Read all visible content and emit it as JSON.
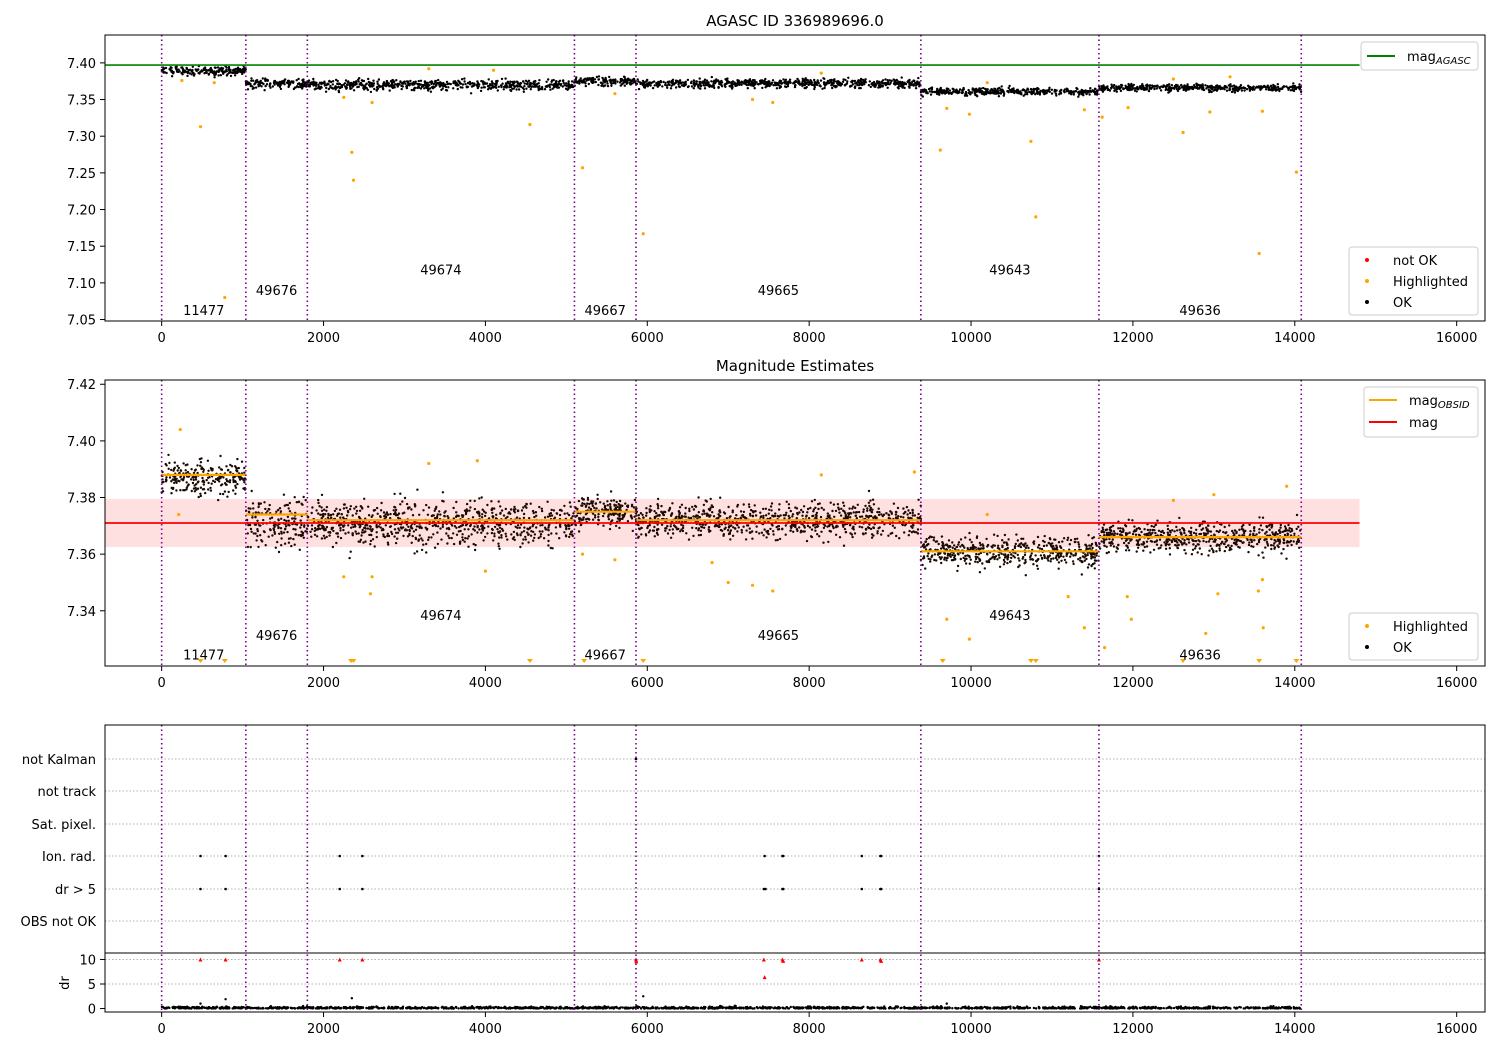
{
  "figure": {
    "title": "AGASC ID 336989696.0"
  },
  "chart_data": [
    {
      "type": "scatter",
      "title": "AGASC ID 336989696.0",
      "xlim": [
        -700,
        16350
      ],
      "ylim": [
        7.048,
        7.438
      ],
      "x_ticks": [
        0,
        2000,
        4000,
        6000,
        8000,
        10000,
        12000,
        14000,
        16000
      ],
      "y_ticks": [
        7.05,
        7.1,
        7.15,
        7.2,
        7.25,
        7.3,
        7.35,
        7.4
      ],
      "y_tick_labels": [
        "7.05",
        "7.10",
        "7.15",
        "7.20",
        "7.25",
        "7.30",
        "7.35",
        "7.40"
      ],
      "reference_line": {
        "name": "mag",
        "subscript": "AGASC",
        "y": 7.397,
        "x_end": 14800,
        "color": "#008000"
      },
      "obs_boundaries": [
        0,
        1040,
        1800,
        5100,
        5860,
        9380,
        11580,
        14080
      ],
      "obs_labels": [
        {
          "text": "11477",
          "x": 520,
          "y": 7.063
        },
        {
          "text": "49676",
          "x": 1420,
          "y": 7.09
        },
        {
          "text": "49674",
          "x": 3450,
          "y": 7.118
        },
        {
          "text": "49667",
          "x": 5480,
          "y": 7.063
        },
        {
          "text": "49665",
          "x": 7620,
          "y": 7.09
        },
        {
          "text": "49643",
          "x": 10480,
          "y": 7.118
        },
        {
          "text": "49636",
          "x": 12830,
          "y": 7.063
        }
      ],
      "segments": [
        {
          "x": [
            0,
            1040
          ],
          "mean": 7.389,
          "spread": 0.005
        },
        {
          "x": [
            1040,
            1800
          ],
          "mean": 7.372,
          "spread": 0.006
        },
        {
          "x": [
            1800,
            5100
          ],
          "mean": 7.37,
          "spread": 0.006
        },
        {
          "x": [
            5100,
            5860
          ],
          "mean": 7.375,
          "spread": 0.005
        },
        {
          "x": [
            5860,
            9380
          ],
          "mean": 7.372,
          "spread": 0.005
        },
        {
          "x": [
            9380,
            11580
          ],
          "mean": 7.361,
          "spread": 0.004
        },
        {
          "x": [
            11580,
            14080
          ],
          "mean": 7.366,
          "spread": 0.004
        }
      ],
      "highlighted_points": [
        {
          "x": 480,
          "y": 7.313
        },
        {
          "x": 780,
          "y": 7.08
        },
        {
          "x": 2350,
          "y": 7.278
        },
        {
          "x": 2370,
          "y": 7.24
        },
        {
          "x": 2600,
          "y": 7.346
        },
        {
          "x": 4550,
          "y": 7.316
        },
        {
          "x": 5200,
          "y": 7.257
        },
        {
          "x": 5950,
          "y": 7.167
        },
        {
          "x": 7300,
          "y": 7.35
        },
        {
          "x": 7550,
          "y": 7.346
        },
        {
          "x": 9620,
          "y": 7.281
        },
        {
          "x": 9700,
          "y": 7.338
        },
        {
          "x": 9980,
          "y": 7.33
        },
        {
          "x": 10740,
          "y": 7.293
        },
        {
          "x": 10800,
          "y": 7.19
        },
        {
          "x": 11620,
          "y": 7.326
        },
        {
          "x": 11940,
          "y": 7.339
        },
        {
          "x": 12620,
          "y": 7.305
        },
        {
          "x": 12950,
          "y": 7.333
        },
        {
          "x": 13560,
          "y": 7.14
        },
        {
          "x": 13600,
          "y": 7.334
        },
        {
          "x": 14020,
          "y": 7.251
        },
        {
          "x": 250,
          "y": 7.376
        },
        {
          "x": 650,
          "y": 7.373
        },
        {
          "x": 2250,
          "y": 7.353
        },
        {
          "x": 3300,
          "y": 7.392
        },
        {
          "x": 4100,
          "y": 7.39
        },
        {
          "x": 5600,
          "y": 7.358
        },
        {
          "x": 8150,
          "y": 7.386
        },
        {
          "x": 10200,
          "y": 7.373
        },
        {
          "x": 11400,
          "y": 7.336
        },
        {
          "x": 12500,
          "y": 7.378
        },
        {
          "x": 13200,
          "y": 7.381
        }
      ],
      "legend": {
        "upper_right": [
          {
            "label": "mag",
            "subscript": "AGASC",
            "color": "#008000",
            "kind": "line"
          }
        ],
        "lower_right": [
          {
            "label": "not OK",
            "color": "#ff0000",
            "kind": "dot"
          },
          {
            "label": "Highlighted",
            "color": "#ffa500",
            "kind": "dot"
          },
          {
            "label": "OK",
            "color": "#000000",
            "kind": "dot"
          }
        ]
      }
    },
    {
      "type": "scatter",
      "title": "Magnitude Estimates",
      "xlim": [
        -700,
        16350
      ],
      "ylim": [
        7.3205,
        7.4215
      ],
      "x_ticks": [
        0,
        2000,
        4000,
        6000,
        8000,
        10000,
        12000,
        14000,
        16000
      ],
      "y_ticks": [
        7.34,
        7.36,
        7.38,
        7.4,
        7.42
      ],
      "y_tick_labels": [
        "7.34",
        "7.36",
        "7.38",
        "7.40",
        "7.42"
      ],
      "mag_line": {
        "name": "mag",
        "y": 7.371,
        "band": [
          7.3625,
          7.3795
        ],
        "x_end": 14800,
        "color": "#ff0000"
      },
      "obsid_means": [
        {
          "x": [
            0,
            1040
          ],
          "y": 7.388
        },
        {
          "x": [
            1040,
            1800
          ],
          "y": 7.374
        },
        {
          "x": [
            1800,
            5100
          ],
          "y": 7.372
        },
        {
          "x": [
            5100,
            5860
          ],
          "y": 7.375
        },
        {
          "x": [
            5860,
            9380
          ],
          "y": 7.372
        },
        {
          "x": [
            9380,
            11580
          ],
          "y": 7.361
        },
        {
          "x": [
            11580,
            14080
          ],
          "y": 7.366
        }
      ],
      "segments": [
        {
          "x": [
            0,
            1040
          ],
          "mean": 7.387,
          "spread": 0.005
        },
        {
          "x": [
            1040,
            1800
          ],
          "mean": 7.371,
          "spread": 0.0065
        },
        {
          "x": [
            1800,
            5100
          ],
          "mean": 7.371,
          "spread": 0.0065
        },
        {
          "x": [
            5100,
            5860
          ],
          "mean": 7.375,
          "spread": 0.005
        },
        {
          "x": [
            5860,
            9380
          ],
          "mean": 7.372,
          "spread": 0.005
        },
        {
          "x": [
            9380,
            11580
          ],
          "mean": 7.361,
          "spread": 0.0045
        },
        {
          "x": [
            11580,
            14080
          ],
          "mean": 7.366,
          "spread": 0.0045
        }
      ],
      "obs_boundaries": [
        0,
        1040,
        1800,
        5100,
        5860,
        9380,
        11580,
        14080
      ],
      "obs_labels": [
        {
          "text": "11477",
          "x": 520,
          "y": 7.3245
        },
        {
          "text": "49676",
          "x": 1420,
          "y": 7.3315
        },
        {
          "text": "49674",
          "x": 3450,
          "y": 7.3385
        },
        {
          "text": "49667",
          "x": 5480,
          "y": 7.3245
        },
        {
          "text": "49665",
          "x": 7620,
          "y": 7.3315
        },
        {
          "text": "49643",
          "x": 10480,
          "y": 7.3385
        },
        {
          "text": "49636",
          "x": 12830,
          "y": 7.3245
        }
      ],
      "highlighted_points": [
        {
          "x": 230,
          "y": 7.404
        },
        {
          "x": 210,
          "y": 7.374
        },
        {
          "x": 2250,
          "y": 7.352
        },
        {
          "x": 2580,
          "y": 7.346
        },
        {
          "x": 2600,
          "y": 7.352
        },
        {
          "x": 3300,
          "y": 7.392
        },
        {
          "x": 3900,
          "y": 7.393
        },
        {
          "x": 4000,
          "y": 7.354
        },
        {
          "x": 5200,
          "y": 7.36
        },
        {
          "x": 5600,
          "y": 7.358
        },
        {
          "x": 6800,
          "y": 7.357
        },
        {
          "x": 7000,
          "y": 7.35
        },
        {
          "x": 7300,
          "y": 7.349
        },
        {
          "x": 7550,
          "y": 7.347
        },
        {
          "x": 8150,
          "y": 7.388
        },
        {
          "x": 9300,
          "y": 7.389
        },
        {
          "x": 9700,
          "y": 7.337
        },
        {
          "x": 9980,
          "y": 7.33
        },
        {
          "x": 10200,
          "y": 7.374
        },
        {
          "x": 11200,
          "y": 7.345
        },
        {
          "x": 11400,
          "y": 7.334
        },
        {
          "x": 11650,
          "y": 7.327
        },
        {
          "x": 11930,
          "y": 7.345
        },
        {
          "x": 11980,
          "y": 7.337
        },
        {
          "x": 12500,
          "y": 7.379
        },
        {
          "x": 12900,
          "y": 7.332
        },
        {
          "x": 13050,
          "y": 7.346
        },
        {
          "x": 13000,
          "y": 7.381
        },
        {
          "x": 13550,
          "y": 7.347
        },
        {
          "x": 13610,
          "y": 7.334
        },
        {
          "x": 13900,
          "y": 7.384
        },
        {
          "x": 13600,
          "y": 7.351
        }
      ],
      "below_range_markers": [
        480,
        780,
        2340,
        2370,
        4550,
        5220,
        5950,
        9650,
        10740,
        10800,
        12620,
        13560,
        14020
      ],
      "legend": {
        "upper_right": [
          {
            "label": "mag",
            "subscript": "OBSID",
            "color": "#ffa500",
            "kind": "line"
          },
          {
            "label": "mag",
            "subscript": "",
            "color": "#ff0000",
            "kind": "line"
          }
        ],
        "lower_right": [
          {
            "label": "Highlighted",
            "color": "#ffa500",
            "kind": "dot"
          },
          {
            "label": "OK",
            "color": "#000000",
            "kind": "dot"
          }
        ]
      }
    },
    {
      "type": "scatter",
      "title": "",
      "xlim": [
        -700,
        16350
      ],
      "x_ticks": [
        0,
        2000,
        4000,
        6000,
        8000,
        10000,
        12000,
        14000,
        16000
      ],
      "flag_rows": [
        "not Kalman",
        "not track",
        "Sat. pixel.",
        "Ion. rad.",
        "dr > 5",
        "OBS not OK"
      ],
      "flag_points": {
        "not Kalman": [
          5860
        ],
        "not track": [],
        "Sat. pixel.": [],
        "Ion. rad.": [
          480,
          790,
          2200,
          2480,
          7450,
          7670,
          7680,
          8650,
          8880,
          8890,
          11580
        ],
        "dr > 5": [
          480,
          790,
          2200,
          2480,
          7440,
          7460,
          7670,
          7680,
          8650,
          8880,
          8890,
          11580
        ],
        "OBS not OK": []
      },
      "dr_ylim": [
        -0.5,
        10.5
      ],
      "dr_ticks": [
        0,
        5,
        10
      ],
      "dr_tick_labels": [
        "0",
        "5",
        "10"
      ],
      "ylabel": "dr",
      "dr_red_points": [
        {
          "x": 480,
          "y": 10
        },
        {
          "x": 790,
          "y": 10
        },
        {
          "x": 2200,
          "y": 10
        },
        {
          "x": 2480,
          "y": 10
        },
        {
          "x": 5860,
          "y": 10
        },
        {
          "x": 5865,
          "y": 9.6
        },
        {
          "x": 7440,
          "y": 10
        },
        {
          "x": 7450,
          "y": 6.4
        },
        {
          "x": 7670,
          "y": 10
        },
        {
          "x": 7680,
          "y": 9.7
        },
        {
          "x": 8650,
          "y": 10
        },
        {
          "x": 8880,
          "y": 10
        },
        {
          "x": 8890,
          "y": 9.7
        },
        {
          "x": 11580,
          "y": 10
        }
      ],
      "dr_black_points": [
        {
          "x": 790,
          "y": 1.9
        },
        {
          "x": 2350,
          "y": 2.1
        },
        {
          "x": 5950,
          "y": 2.5
        },
        {
          "x": 480,
          "y": 1.0
        },
        {
          "x": 9700,
          "y": 1.0
        }
      ],
      "obs_boundaries": [
        0,
        1040,
        1800,
        5100,
        5860,
        9380,
        11580,
        14080
      ]
    }
  ]
}
